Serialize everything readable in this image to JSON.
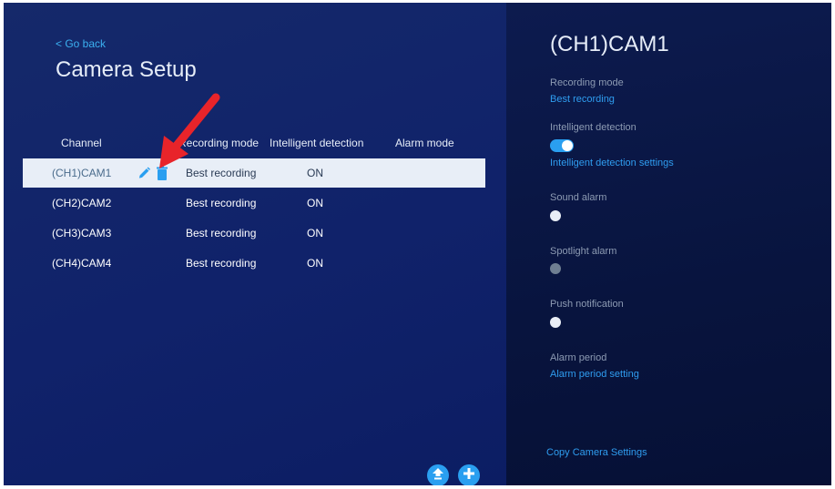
{
  "left_panel": {
    "go_back": "< Go back",
    "title": "Camera Setup",
    "columns": [
      "Channel",
      "Recording mode",
      "Intelligent detection",
      "Alarm mode"
    ],
    "rows": [
      {
        "channel": "(CH1)CAM1",
        "recording_mode": "Best recording",
        "intelligent_detection": "ON",
        "alarm_mode": "",
        "selected": true
      },
      {
        "channel": "(CH2)CAM2",
        "recording_mode": "Best recording",
        "intelligent_detection": "ON",
        "alarm_mode": ""
      },
      {
        "channel": "(CH3)CAM3",
        "recording_mode": "Best recording",
        "intelligent_detection": "ON",
        "alarm_mode": ""
      },
      {
        "channel": "(CH4)CAM4",
        "recording_mode": "Best recording",
        "intelligent_detection": "ON",
        "alarm_mode": ""
      }
    ],
    "row_icons": [
      "pencil-icon",
      "trash-icon"
    ],
    "bottom_buttons": [
      "upload-icon",
      "plus-icon"
    ]
  },
  "right_panel": {
    "title": "(CH1)CAM1",
    "recording_mode_label": "Recording mode",
    "recording_mode_value": "Best recording",
    "intelligent_detection_label": "Intelligent detection",
    "intelligent_detection_enabled": true,
    "intelligent_detection_settings": "Intelligent detection settings",
    "sound_alarm_label": "Sound alarm",
    "spotlight_alarm_label": "Spotlight alarm",
    "push_notification_label": "Push notification",
    "alarm_period_label": "Alarm period",
    "alarm_period_setting": "Alarm period setting",
    "copy_settings": "Copy Camera Settings"
  },
  "colors": {
    "accent": "#2a9ff0",
    "link": "#2f9df0",
    "arrow": "#e8242a",
    "selected_row": "#e8eef7"
  }
}
